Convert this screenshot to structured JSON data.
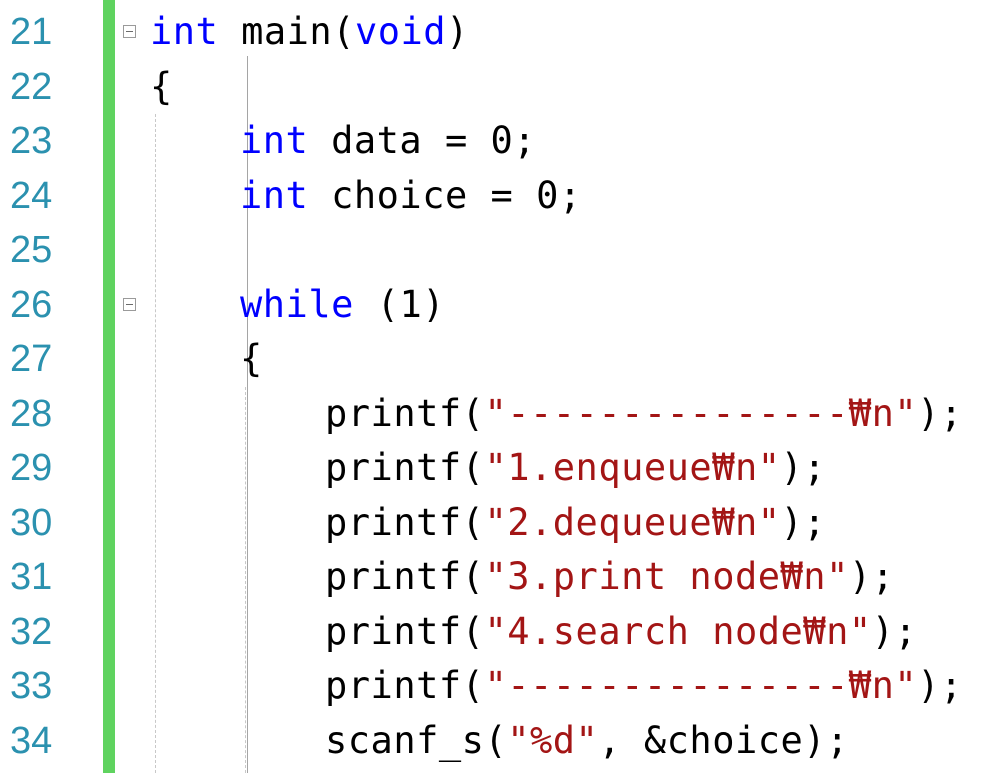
{
  "editor": {
    "line_numbers": [
      "21",
      "22",
      "23",
      "24",
      "25",
      "26",
      "27",
      "28",
      "29",
      "30",
      "31",
      "32",
      "33",
      "34"
    ],
    "lines": [
      {
        "indent": 0,
        "tokens": [
          {
            "t": "int",
            "k": "kw"
          },
          {
            "t": " main("
          },
          {
            "t": "void",
            "k": "kw"
          },
          {
            "t": ")"
          }
        ]
      },
      {
        "indent": 0,
        "tokens": [
          {
            "t": "{"
          }
        ]
      },
      {
        "indent": 1,
        "tokens": [
          {
            "t": "int",
            "k": "kw"
          },
          {
            "t": " data = 0;"
          }
        ]
      },
      {
        "indent": 1,
        "tokens": [
          {
            "t": "int",
            "k": "kw"
          },
          {
            "t": " choice = 0;"
          }
        ]
      },
      {
        "indent": 0,
        "tokens": []
      },
      {
        "indent": 1,
        "tokens": [
          {
            "t": "while",
            "k": "kw"
          },
          {
            "t": " (1)"
          }
        ]
      },
      {
        "indent": 1,
        "tokens": [
          {
            "t": "{"
          }
        ]
      },
      {
        "indent": 2,
        "tokens": [
          {
            "t": "printf("
          },
          {
            "t": "\"---------------₩n\"",
            "k": "str"
          },
          {
            "t": ");"
          }
        ]
      },
      {
        "indent": 2,
        "tokens": [
          {
            "t": "printf("
          },
          {
            "t": "\"1.enqueue₩n\"",
            "k": "str"
          },
          {
            "t": ");"
          }
        ]
      },
      {
        "indent": 2,
        "tokens": [
          {
            "t": "printf("
          },
          {
            "t": "\"2.dequeue₩n\"",
            "k": "str"
          },
          {
            "t": ");"
          }
        ]
      },
      {
        "indent": 2,
        "tokens": [
          {
            "t": "printf("
          },
          {
            "t": "\"3.print node₩n\"",
            "k": "str"
          },
          {
            "t": ");"
          }
        ]
      },
      {
        "indent": 2,
        "tokens": [
          {
            "t": "printf("
          },
          {
            "t": "\"4.search node₩n\"",
            "k": "str"
          },
          {
            "t": ");"
          }
        ]
      },
      {
        "indent": 2,
        "tokens": [
          {
            "t": "printf("
          },
          {
            "t": "\"---------------₩n\"",
            "k": "str"
          },
          {
            "t": ");"
          }
        ]
      },
      {
        "indent": 2,
        "tokens": [
          {
            "t": "scanf_s("
          },
          {
            "t": "\"%d\"",
            "k": "str"
          },
          {
            "t": ", &choice);"
          }
        ]
      }
    ]
  },
  "colors": {
    "keyword": "#0000ff",
    "string": "#a31515",
    "line_number": "#2b91af",
    "change_bar": "#5fd35f"
  },
  "icons": {
    "fold": "collapse-minus-icon"
  }
}
